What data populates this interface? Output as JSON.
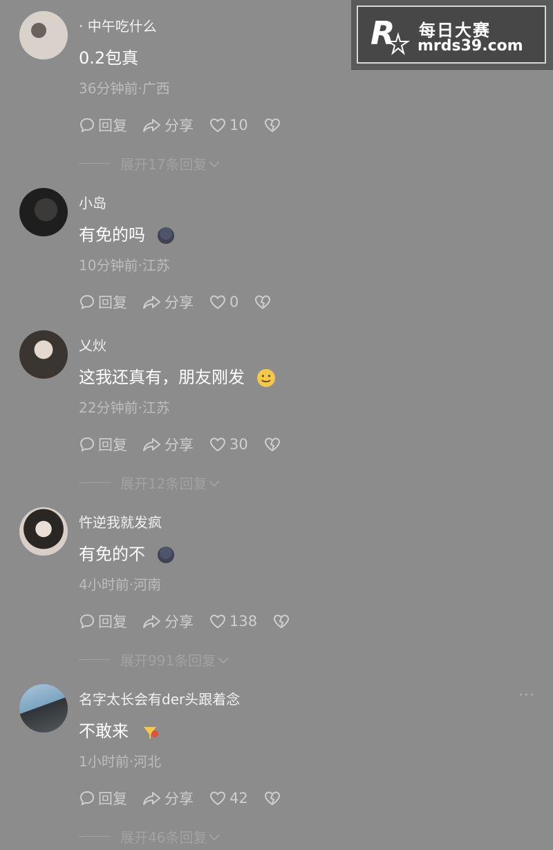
{
  "watermark": {
    "logo_text": "R",
    "title": "每日大赛",
    "url": "mrds39.com"
  },
  "labels": {
    "reply": "回复",
    "share": "分享"
  },
  "comments": [
    {
      "username": "· 中午吃什么",
      "text": "0.2包真",
      "emoji": "",
      "meta": "36分钟前·广西",
      "likes": "10",
      "expand": "展开17条回复"
    },
    {
      "username": "小岛",
      "text": "有免的吗",
      "emoji": "dark-blob-emoji",
      "meta": "10分钟前·江苏",
      "likes": "0",
      "expand": ""
    },
    {
      "username": "乂炏",
      "text": "这我还真有，朋友刚发",
      "emoji": "smile-emoji",
      "meta": "22分钟前·江苏",
      "likes": "30",
      "expand": "展开12条回复"
    },
    {
      "username": "忤逆我就发疯",
      "text": "有免的不",
      "emoji": "dark-blob-emoji",
      "meta": "4小时前·河南",
      "likes": "138",
      "expand": "展开991条回复"
    },
    {
      "username": "名字太长会有der头跟着念",
      "text": "不敢来",
      "emoji": "cocktail-emoji",
      "meta": "1小时前·河北",
      "likes": "42",
      "expand": "展开46条回复"
    }
  ],
  "colors": {
    "background": "#8c8c8c",
    "text": "#ffffff",
    "muted": "#bdbdbd"
  }
}
